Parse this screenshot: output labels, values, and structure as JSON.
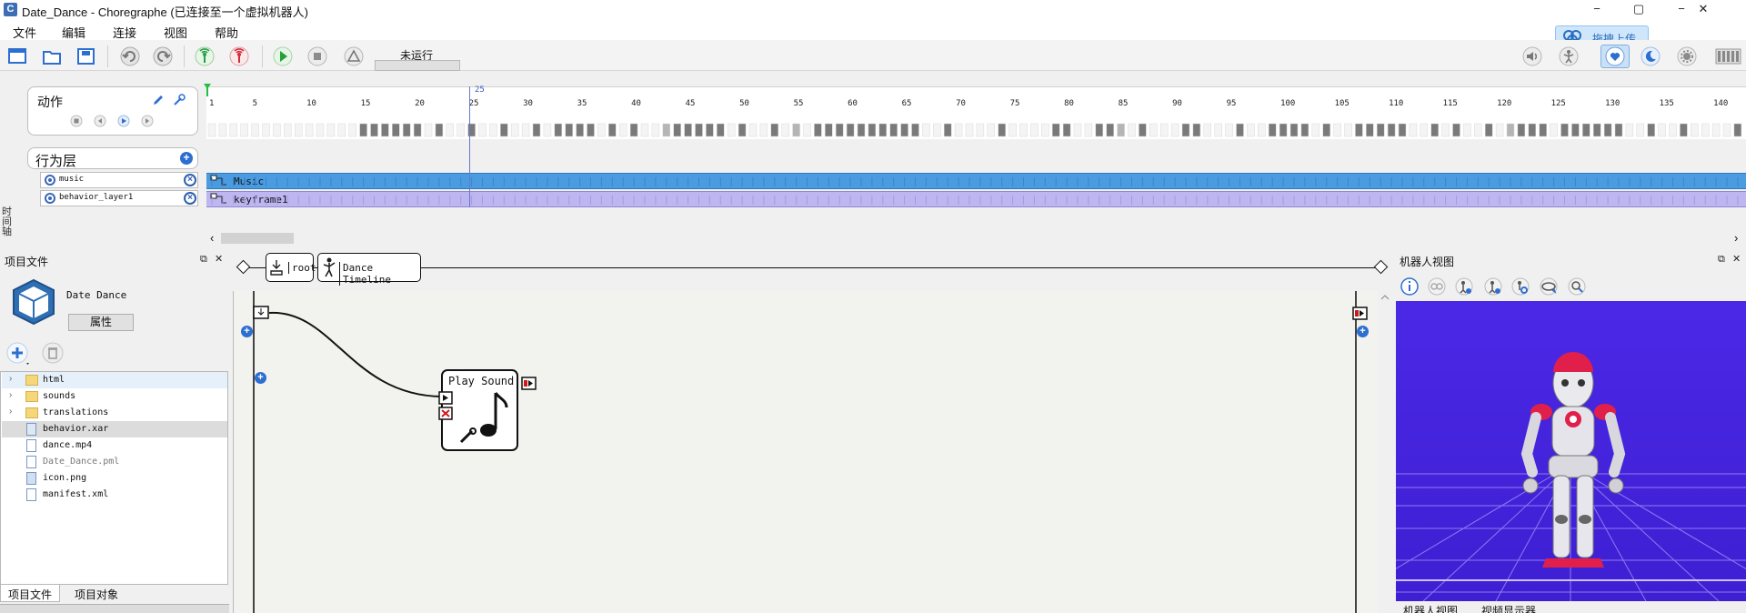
{
  "window": {
    "app_icon_letter": "C",
    "title": "Date_Dance - Choregraphe (已连接至一个虚拟机器人)",
    "minimize": "−",
    "maximize": "▢",
    "close": "✕"
  },
  "menu": {
    "items": [
      "文件",
      "编辑",
      "连接",
      "视图",
      "帮助"
    ]
  },
  "toolbar": {
    "run_status": "未运行",
    "upload_label": "拖拽上传"
  },
  "timeline": {
    "vertical_label": "时间轴",
    "motion_title": "动作",
    "layers_title": "行为层",
    "playhead_frame": "25",
    "ruler_ticks": [
      "1",
      "5",
      "10",
      "15",
      "20",
      "25",
      "30",
      "35",
      "40",
      "45",
      "50",
      "55",
      "60",
      "65",
      "70",
      "75",
      "80",
      "85",
      "90",
      "95",
      "100",
      "105",
      "110",
      "115",
      "120",
      "125",
      "130",
      "135",
      "140"
    ],
    "layers": [
      {
        "name": "music",
        "track": "Music"
      },
      {
        "name": "behavior_layer1",
        "track": "keyframe1"
      }
    ],
    "scroll_left": "‹",
    "scroll_right": "›"
  },
  "project_panel": {
    "title": "项目文件",
    "project_name": "Date Dance",
    "properties_button": "属性",
    "files": [
      {
        "name": "html",
        "type": "folder",
        "expandable": true
      },
      {
        "name": "sounds",
        "type": "folder",
        "expandable": true
      },
      {
        "name": "translations",
        "type": "folder",
        "expandable": true
      },
      {
        "name": "behavior.xar",
        "type": "file",
        "expandable": false
      },
      {
        "name": "dance.mp4",
        "type": "file",
        "expandable": false
      },
      {
        "name": "Date_Dance.pml",
        "type": "file",
        "expandable": false
      },
      {
        "name": "icon.png",
        "type": "file",
        "expandable": false
      },
      {
        "name": "manifest.xml",
        "type": "file",
        "expandable": false
      }
    ],
    "tabs": [
      "项目文件",
      "项目对象"
    ]
  },
  "flow": {
    "breadcrumb": [
      "root",
      "Dance Timeline"
    ],
    "box_title": "Play Sound"
  },
  "robot_panel": {
    "title": "机器人视图",
    "tabs": [
      "机器人视图",
      "视频显示器"
    ]
  },
  "colors": {
    "accent": "#2d6fd0",
    "music_track": "#4b9be0",
    "keyframe_track": "#bdb6f0",
    "robot_bg": "#4b28e6"
  }
}
